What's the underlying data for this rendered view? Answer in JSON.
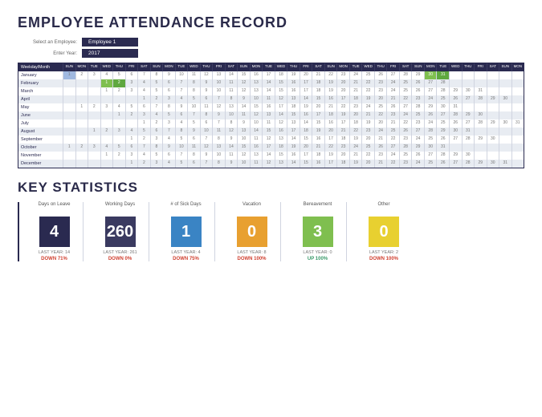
{
  "title": "EMPLOYEE ATTENDANCE RECORD",
  "selectors": {
    "employee_label": "Select an Employee:",
    "employee_value": "Employee 1",
    "year_label": "Enter Year:",
    "year_value": "2017"
  },
  "grid": {
    "header_label": "Weekday/Month",
    "day_headers": [
      "SUN",
      "MON",
      "TUE",
      "WED",
      "THU",
      "FRI",
      "SAT",
      "SUN",
      "MON",
      "TUE",
      "WED",
      "THU",
      "FRI",
      "SAT",
      "SUN",
      "MON",
      "TUE",
      "WED",
      "THU",
      "FRI",
      "SAT",
      "SUN",
      "MON",
      "TUE",
      "WED",
      "THU",
      "FRI",
      "SAT",
      "SUN",
      "MON",
      "TUE",
      "WED",
      "THU",
      "FRI",
      "SAT",
      "SUN",
      "MON"
    ],
    "rows": [
      {
        "month": "January",
        "offset": 0,
        "days": 31,
        "marks": {
          "1": "b1",
          "30": "g1",
          "31": "g2"
        }
      },
      {
        "month": "February",
        "offset": 3,
        "days": 28,
        "marks": {
          "1": "g1",
          "2": "g2"
        }
      },
      {
        "month": "March",
        "offset": 3,
        "days": 31,
        "marks": {}
      },
      {
        "month": "April",
        "offset": 6,
        "days": 30,
        "marks": {}
      },
      {
        "month": "May",
        "offset": 1,
        "days": 31,
        "marks": {}
      },
      {
        "month": "June",
        "offset": 4,
        "days": 30,
        "marks": {}
      },
      {
        "month": "July",
        "offset": 6,
        "days": 31,
        "marks": {}
      },
      {
        "month": "August",
        "offset": 2,
        "days": 31,
        "marks": {}
      },
      {
        "month": "September",
        "offset": 5,
        "days": 30,
        "marks": {}
      },
      {
        "month": "October",
        "offset": 0,
        "days": 31,
        "marks": {}
      },
      {
        "month": "November",
        "offset": 3,
        "days": 30,
        "marks": {}
      },
      {
        "month": "December",
        "offset": 5,
        "days": 31,
        "marks": {}
      }
    ]
  },
  "key_stats": {
    "title": "KEY STATISTICS",
    "cards": [
      {
        "label": "Days on Leave",
        "value": "4",
        "color": "#2a2a50",
        "last_year": "LAST YEAR: 14",
        "change": "DOWN 71%",
        "dir": "down"
      },
      {
        "label": "Working Days",
        "value": "260",
        "color": "#3a3a60",
        "last_year": "LAST YEAR: 261",
        "change": "DOWN 0%",
        "dir": "down"
      },
      {
        "label": "# of Sick Days",
        "value": "1",
        "color": "#3a84c4",
        "last_year": "LAST YEAR: 4",
        "change": "DOWN 75%",
        "dir": "down"
      },
      {
        "label": "Vacation",
        "value": "0",
        "color": "#e8a030",
        "last_year": "LAST YEAR: 8",
        "change": "DOWN 100%",
        "dir": "down"
      },
      {
        "label": "Bereavement",
        "value": "3",
        "color": "#7fbf4f",
        "last_year": "LAST YEAR: 0",
        "change": "UP 100%",
        "dir": "up"
      },
      {
        "label": "Other",
        "value": "0",
        "color": "#e8d030",
        "last_year": "LAST YEAR: 2",
        "change": "DOWN 100%",
        "dir": "down"
      }
    ]
  }
}
